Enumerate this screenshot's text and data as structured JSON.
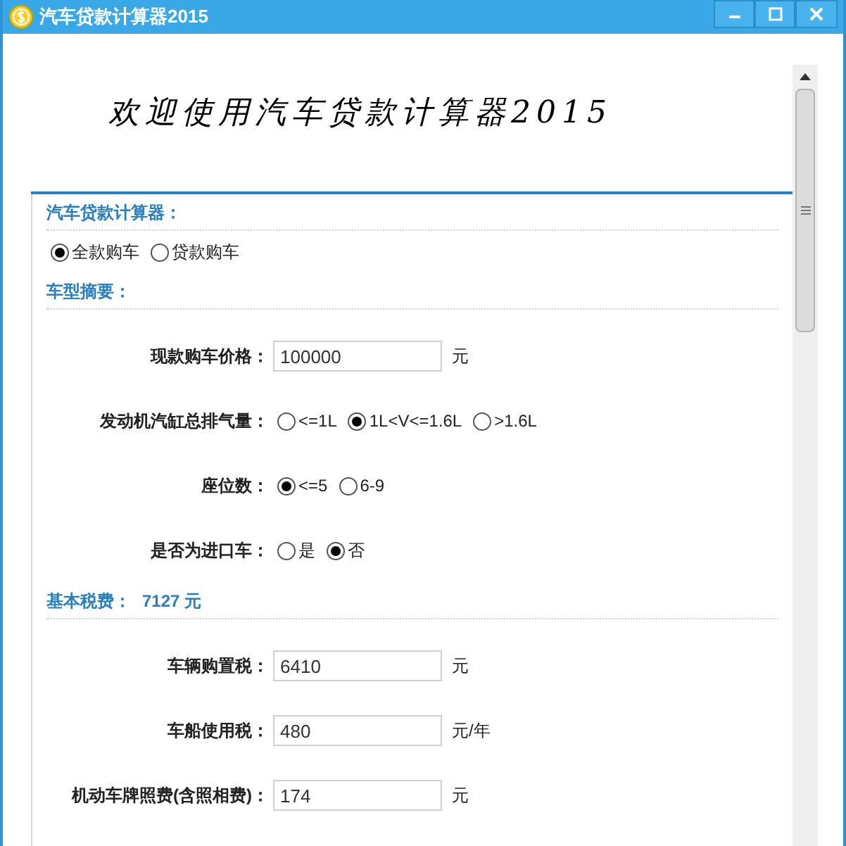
{
  "window": {
    "title": "汽车贷款计算器2015"
  },
  "banner": "欢迎使用汽车贷款计算器2015",
  "purchase": {
    "heading": "汽车贷款计算器：",
    "options": [
      {
        "label": "全款购车",
        "selected": true
      },
      {
        "label": "贷款购车",
        "selected": false
      }
    ]
  },
  "car_summary": {
    "heading": "车型摘要：",
    "rows": [
      {
        "kind": "input",
        "label": "现款购车价格：",
        "value": "100000",
        "unit": "元"
      },
      {
        "kind": "radio",
        "label": "发动机汽缸总排气量：",
        "options": [
          {
            "label": "<=1L",
            "selected": false
          },
          {
            "label": "1L<V<=1.6L",
            "selected": true
          },
          {
            "label": ">1.6L",
            "selected": false
          }
        ]
      },
      {
        "kind": "radio",
        "label": "座位数：",
        "options": [
          {
            "label": "<=5",
            "selected": true
          },
          {
            "label": "6-9",
            "selected": false
          }
        ]
      },
      {
        "kind": "radio",
        "label": "是否为进口车：",
        "options": [
          {
            "label": "是",
            "selected": false
          },
          {
            "label": "否",
            "selected": true
          }
        ]
      }
    ]
  },
  "base_tax": {
    "heading": "基本税费：",
    "amount": "7127 元",
    "rows": [
      {
        "kind": "input",
        "label": "车辆购置税：",
        "value": "6410",
        "unit": "元"
      },
      {
        "kind": "input",
        "label": "车船使用税：",
        "value": "480",
        "unit": "元/年"
      },
      {
        "kind": "input",
        "label": "机动车牌照费(含照相费)：",
        "value": "174",
        "unit": "元"
      }
    ]
  }
}
